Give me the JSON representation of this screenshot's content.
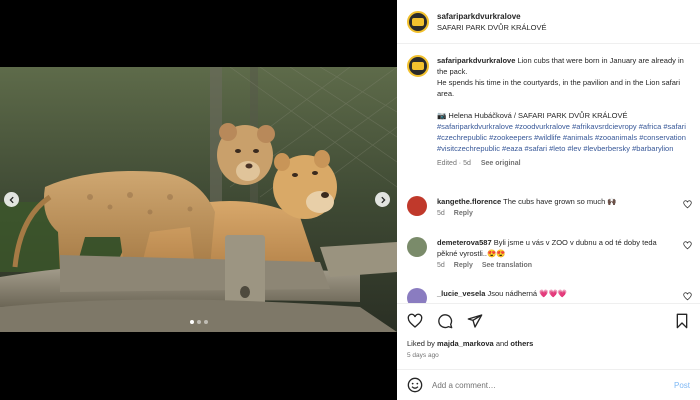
{
  "account": {
    "username": "safariparkdvurkralove",
    "subtitle": "SAFARI PARK DVŮR KRÁLOVÉ"
  },
  "media": {
    "image_alt": "Lion cub standing on a log next to a lioness",
    "nav_prev_icon": "chevron-left-icon",
    "nav_next_icon": "chevron-right-icon",
    "slide_count": 3,
    "active_slide": 1
  },
  "caption": {
    "username": "safariparkdvurkralove",
    "text_1": " Lion cubs that were born in January are already in the pack.",
    "text_2": "He spends his time in the courtyards, in the pavilion and in the Lion safari area.",
    "credit": "📷 Helena Hubáčková / SAFARI PARK DVŮR KRÁLOVÉ",
    "hashtags": "#safariparkdvurkralove #zoodvurkralove #afrikavsrdcievropy #africa #safari #czechrepublic #zookeepers #wildlife #animals #zooanimals #conservation #visitczechrepublic #eaza #safari #leto #lev #levberbersky #barbarylion",
    "edited": "Edited · 5d",
    "see_original": "See original"
  },
  "comments": [
    {
      "username": "kangethe.florence",
      "text": " The cubs have grown so much 🙌🏿",
      "age": "5d",
      "reply": "Reply",
      "translation": "",
      "avatar_color": "#c0392b"
    },
    {
      "username": "demeterova587",
      "text": " Byli jsme u vás v ZOO v dubnu a od té doby teda pěkné vyrostli..😍😍",
      "age": "5d",
      "reply": "Reply",
      "translation": "See translation",
      "avatar_color": "#7a8b6a"
    },
    {
      "username": "_lucie_vesela",
      "text": " Jsou nádherná 💗💗💗",
      "age": "",
      "reply": "",
      "translation": "",
      "avatar_color": "#8a7cc0"
    }
  ],
  "actions": {
    "icons": [
      "heart-icon",
      "comment-icon",
      "share-icon"
    ],
    "save_icon": "bookmark-icon",
    "liked_by_prefix": "Liked by ",
    "liked_by_user": "majda_markova",
    "liked_by_and": " and ",
    "liked_by_others": "others",
    "posted_ago": "5 days ago"
  },
  "composer": {
    "placeholder": "Add a comment…",
    "post_label": "Post",
    "emoji_icon": "emoji-icon"
  },
  "colors": {
    "link": "#385898",
    "post_button": "#7eb8f5",
    "muted": "#737373"
  }
}
